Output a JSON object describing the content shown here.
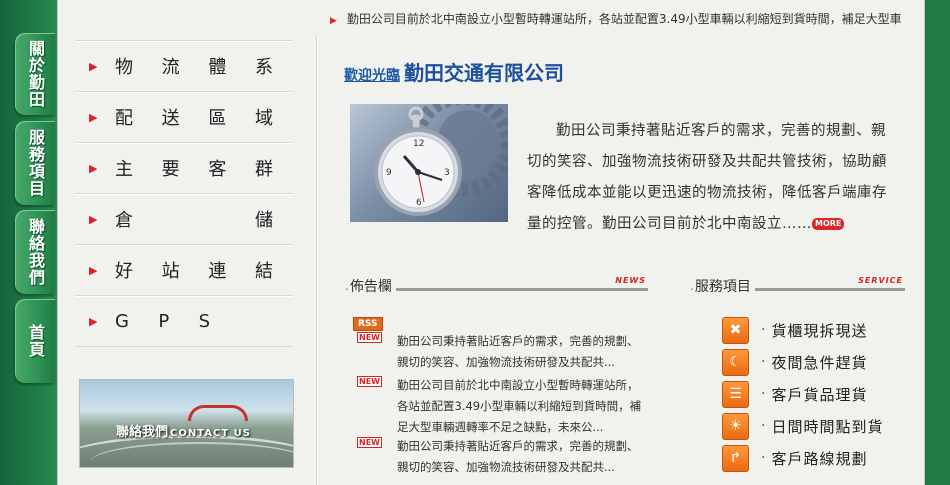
{
  "colors": {
    "brand_green": "#1f7a44",
    "accent_red": "#d62a2a",
    "title_blue": "#1c4f9c",
    "service_orange": "#ea6a12"
  },
  "marquee": {
    "text": "勤田公司目前於北中南設立小型暫時轉運站所，各站並配置3.49小型車輛以利縮短到貨時間，補足大型車"
  },
  "side_tabs": [
    {
      "label": "關於勤田"
    },
    {
      "label": "服務項目"
    },
    {
      "label": "聯絡我們"
    },
    {
      "label": "首頁"
    }
  ],
  "menu": [
    {
      "chars": [
        "物",
        "流",
        "體",
        "系"
      ]
    },
    {
      "chars": [
        "配",
        "送",
        "區",
        "域"
      ]
    },
    {
      "chars": [
        "主",
        "要",
        "客",
        "群"
      ]
    },
    {
      "chars": [
        "倉",
        "儲"
      ]
    },
    {
      "chars": [
        "好",
        "站",
        "連",
        "結"
      ]
    },
    {
      "chars": [
        "G",
        "P",
        "S"
      ]
    }
  ],
  "contact_banner": {
    "zh": "聯絡我們",
    "en": "CONTACT US"
  },
  "welcome": {
    "small": "歡迎光臨",
    "big": "勤田交通有限公司"
  },
  "intro": {
    "text": "勤田公司秉持著貼近客戶的需求，完善的規劃、親切的笑容、加強物流技術研發及共配共管技術，協助顧客降低成本並能以更迅速的物流技術，降低客戶端庫存量的控管。勤田公司目前於北中南設立……",
    "more": "MORE"
  },
  "news": {
    "title": "佈告欄",
    "tag": "NEWS",
    "rss": "RSS",
    "badge": "NEW",
    "items": [
      {
        "text": "勤田公司秉持著貼近客戶的需求，完善的規劃、親切的笑容、加強物流技術研發及共配共..."
      },
      {
        "text": "勤田公司目前於北中南設立小型暫時轉運站所，各站並配置3.49小型車輛以利縮短到貨時間，補足大型車輛週轉率不足之缺點，未來公..."
      },
      {
        "text": "勤田公司秉持著貼近客戶的需求，完善的規劃、親切的笑容、加強物流技術研發及共配共..."
      }
    ]
  },
  "services": {
    "title": "服務項目",
    "tag": "SERVICE",
    "items": [
      {
        "label": "貨櫃現拆現送",
        "icon": "tools-icon"
      },
      {
        "label": "夜間急件趕貨",
        "icon": "night-truck-icon"
      },
      {
        "label": "客戶貨品理貨",
        "icon": "shelf-icon"
      },
      {
        "label": "日間時間點到貨",
        "icon": "day-truck-icon"
      },
      {
        "label": "客戶路線規劃",
        "icon": "route-icon"
      }
    ]
  }
}
